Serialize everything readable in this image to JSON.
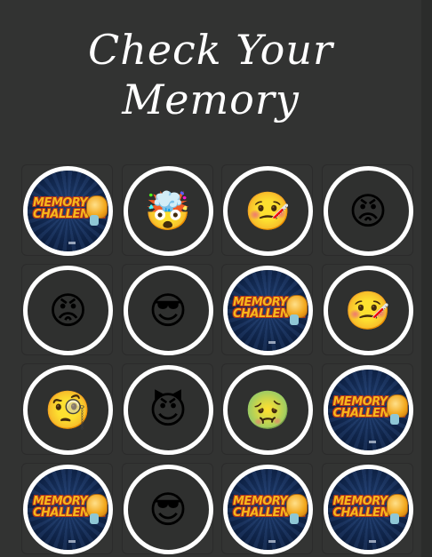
{
  "title": "Check Your Memory",
  "card_back": {
    "logo_line1": "MEMORY",
    "logo_line2": "CHALLENGE"
  },
  "colors": {
    "background": "#333433",
    "ring": "#ffffff",
    "card_back": "#0f2449",
    "logo": "#f6b81c"
  },
  "grid": {
    "rows": 4,
    "columns": 4,
    "cards": [
      {
        "state": "hidden"
      },
      {
        "state": "revealed",
        "icon": "exploding-head-icon",
        "glyph": "🤯"
      },
      {
        "state": "revealed",
        "icon": "face-with-thermometer-icon",
        "glyph": "🤒"
      },
      {
        "state": "revealed",
        "icon": "angry-face-icon",
        "glyph": "😡"
      },
      {
        "state": "revealed",
        "icon": "angry-face-icon",
        "glyph": "😡"
      },
      {
        "state": "revealed",
        "icon": "sunglasses-face-icon",
        "glyph": "😎"
      },
      {
        "state": "hidden"
      },
      {
        "state": "revealed",
        "icon": "face-with-thermometer-icon",
        "glyph": "🤒"
      },
      {
        "state": "revealed",
        "icon": "monocle-face-icon",
        "glyph": "🧐"
      },
      {
        "state": "revealed",
        "icon": "smiling-devil-icon",
        "glyph": "😈"
      },
      {
        "state": "revealed",
        "icon": "nauseated-face-icon",
        "glyph": "🤢"
      },
      {
        "state": "hidden"
      },
      {
        "state": "hidden"
      },
      {
        "state": "revealed",
        "icon": "sunglasses-face-icon",
        "glyph": "😎"
      },
      {
        "state": "hidden"
      },
      {
        "state": "hidden"
      }
    ]
  }
}
